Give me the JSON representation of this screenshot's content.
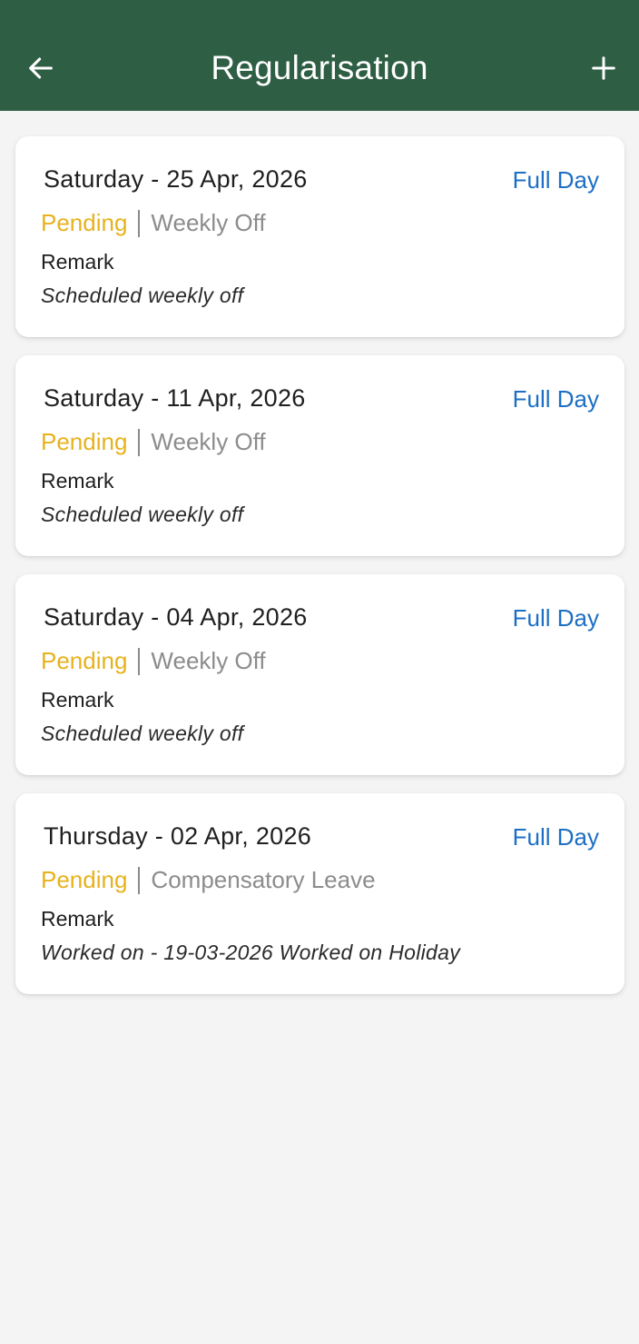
{
  "header": {
    "title": "Regularisation",
    "back_icon": "arrow-left-icon",
    "add_icon": "plus-icon",
    "background_color": "#2e5e44"
  },
  "colors": {
    "status_pending": "#e7b21c",
    "duration": "#1c6fc4",
    "type": "#8c8c8c"
  },
  "requests": [
    {
      "date": "Saturday - 25 Apr, 2026",
      "duration": "Full Day",
      "status": "Pending",
      "type": "Weekly Off",
      "remark_label": "Remark",
      "remark": "Scheduled weekly off"
    },
    {
      "date": "Saturday - 11 Apr, 2026",
      "duration": "Full Day",
      "status": "Pending",
      "type": "Weekly Off",
      "remark_label": "Remark",
      "remark": "Scheduled weekly off"
    },
    {
      "date": "Saturday - 04 Apr, 2026",
      "duration": "Full Day",
      "status": "Pending",
      "type": "Weekly Off",
      "remark_label": "Remark",
      "remark": "Scheduled weekly off"
    },
    {
      "date": "Thursday - 02 Apr, 2026",
      "duration": "Full Day",
      "status": "Pending",
      "type": "Compensatory Leave",
      "remark_label": "Remark",
      "remark": "Worked on - 19-03-2026 Worked on Holiday"
    }
  ]
}
